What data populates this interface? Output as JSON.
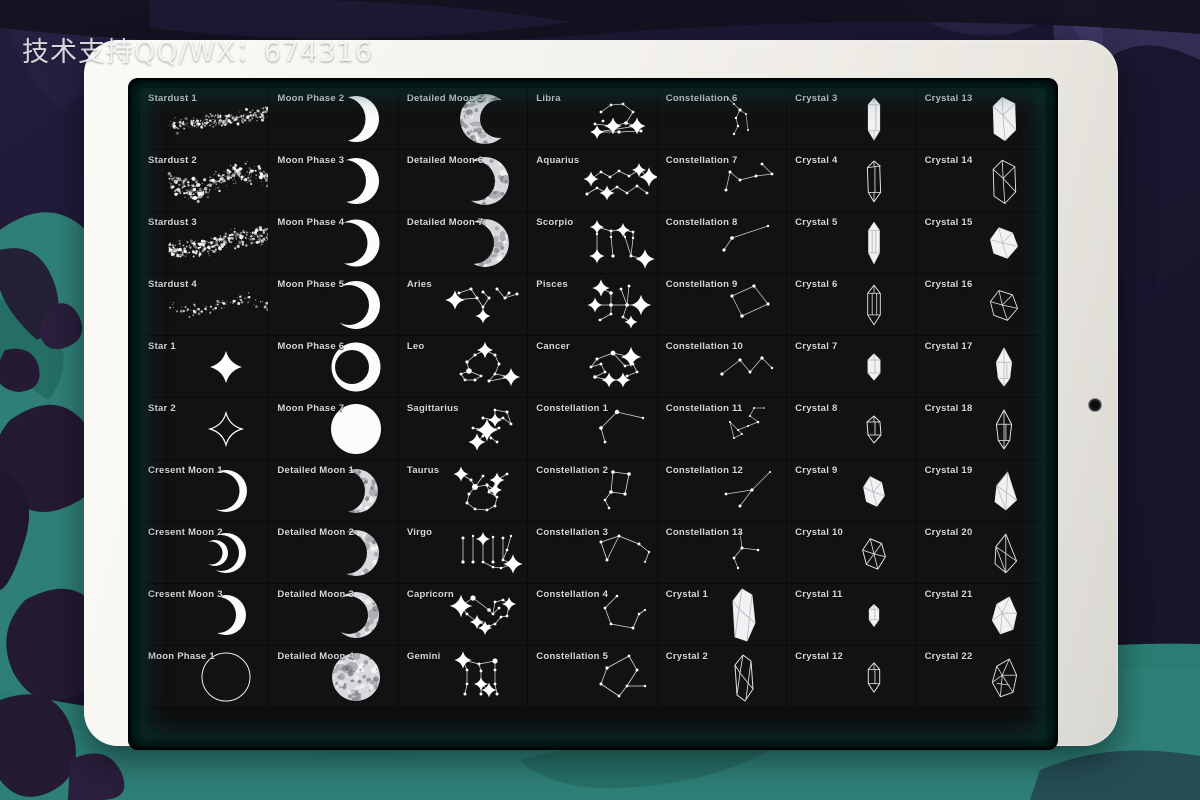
{
  "watermark": {
    "text": "技术支持QQ/WX：674316"
  },
  "device": {
    "name": "tablet",
    "bezel_color": "#f5f3ed",
    "screen_color": "#030304",
    "glow_color": "#0b7065",
    "camera_icon": "camera-dot"
  },
  "background": {
    "base_color": "#1b1530",
    "accent_teal": "#2e8077",
    "accent_purple": "#3a3560",
    "dark_plum": "#241a33"
  },
  "grid": {
    "columns": 7,
    "rows": 10,
    "label_color": "#d8d8da",
    "cell_color": "#121213",
    "items": [
      {
        "label": "Stardust 1",
        "art": "stardust-1",
        "wide": true
      },
      {
        "label": "Moon Phase 2",
        "art": "moon-phase-2"
      },
      {
        "label": "Detailed Moon 5",
        "art": "detailed-moon-5"
      },
      {
        "label": "Libra",
        "art": "libra"
      },
      {
        "label": "Constellation 6",
        "art": "constellation-6"
      },
      {
        "label": "Crystal 3",
        "art": "crystal-3"
      },
      {
        "label": "Crystal 13",
        "art": "crystal-13"
      },
      {
        "label": "Stardust 2",
        "art": "stardust-2",
        "wide": true
      },
      {
        "label": "Moon Phase 3",
        "art": "moon-phase-3"
      },
      {
        "label": "Detailed Moon 6",
        "art": "detailed-moon-6"
      },
      {
        "label": "Aquarius",
        "art": "aquarius"
      },
      {
        "label": "Constellation 7",
        "art": "constellation-7"
      },
      {
        "label": "Crystal 4",
        "art": "crystal-4"
      },
      {
        "label": "Crystal 14",
        "art": "crystal-14"
      },
      {
        "label": "Stardust 3",
        "art": "stardust-3",
        "wide": true
      },
      {
        "label": "Moon Phase 4",
        "art": "moon-phase-4"
      },
      {
        "label": "Detailed Moon 7",
        "art": "detailed-moon-7"
      },
      {
        "label": "Scorpio",
        "art": "scorpio"
      },
      {
        "label": "Constellation 8",
        "art": "constellation-8"
      },
      {
        "label": "Crystal 5",
        "art": "crystal-5"
      },
      {
        "label": "Crystal 15",
        "art": "crystal-15"
      },
      {
        "label": "Stardust 4",
        "art": "stardust-4",
        "wide": true
      },
      {
        "label": "Moon Phase 5",
        "art": "moon-phase-5"
      },
      {
        "label": "Aries",
        "art": "aries"
      },
      {
        "label": "Pisces",
        "art": "pisces"
      },
      {
        "label": "Constellation 9",
        "art": "constellation-9"
      },
      {
        "label": "Crystal 6",
        "art": "crystal-6"
      },
      {
        "label": "Crystal 16",
        "art": "crystal-16"
      },
      {
        "label": "Star 1",
        "art": "star-1"
      },
      {
        "label": "Moon Phase 6",
        "art": "moon-phase-6"
      },
      {
        "label": "Leo",
        "art": "leo"
      },
      {
        "label": "Cancer",
        "art": "cancer"
      },
      {
        "label": "Constellation 10",
        "art": "constellation-10"
      },
      {
        "label": "Crystal 7",
        "art": "crystal-7"
      },
      {
        "label": "Crystal 17",
        "art": "crystal-17"
      },
      {
        "label": "Star 2",
        "art": "star-2"
      },
      {
        "label": "Moon Phase 7",
        "art": "moon-phase-7"
      },
      {
        "label": "Sagittarius",
        "art": "sagittarius"
      },
      {
        "label": "Constellation 1",
        "art": "constellation-1"
      },
      {
        "label": "Constellation 11",
        "art": "constellation-11"
      },
      {
        "label": "Crystal 8",
        "art": "crystal-8"
      },
      {
        "label": "Crystal 18",
        "art": "crystal-18"
      },
      {
        "label": "Cresent Moon 1",
        "art": "cresent-moon-1"
      },
      {
        "label": "Detailed Moon 1",
        "art": "detailed-moon-1"
      },
      {
        "label": "Taurus",
        "art": "taurus"
      },
      {
        "label": "Constellation 2",
        "art": "constellation-2"
      },
      {
        "label": "Constellation 12",
        "art": "constellation-12"
      },
      {
        "label": "Crystal 9",
        "art": "crystal-9"
      },
      {
        "label": "Crystal 19",
        "art": "crystal-19"
      },
      {
        "label": "Cresent Moon 2",
        "art": "cresent-moon-2"
      },
      {
        "label": "Detailed Moon 2",
        "art": "detailed-moon-2"
      },
      {
        "label": "Virgo",
        "art": "virgo"
      },
      {
        "label": "Constellation 3",
        "art": "constellation-3"
      },
      {
        "label": "Constellation 13",
        "art": "constellation-13"
      },
      {
        "label": "Crystal 10",
        "art": "crystal-10"
      },
      {
        "label": "Crystal 20",
        "art": "crystal-20"
      },
      {
        "label": "Cresent Moon 3",
        "art": "cresent-moon-3"
      },
      {
        "label": "Detailed Moon 3",
        "art": "detailed-moon-3"
      },
      {
        "label": "Capricorn",
        "art": "capricorn"
      },
      {
        "label": "Constellation 4",
        "art": "constellation-4"
      },
      {
        "label": "Crystal 1",
        "art": "crystal-1"
      },
      {
        "label": "Crystal 11",
        "art": "crystal-11"
      },
      {
        "label": "Crystal 21",
        "art": "crystal-21"
      },
      {
        "label": "Moon Phase 1",
        "art": "moon-phase-1"
      },
      {
        "label": "Detailed Moon 4",
        "art": "detailed-moon-4"
      },
      {
        "label": "Gemini",
        "art": "gemini"
      },
      {
        "label": "Constellation 5",
        "art": "constellation-5"
      },
      {
        "label": "Crystal 2",
        "art": "crystal-2"
      },
      {
        "label": "Crystal 12",
        "art": "crystal-12"
      },
      {
        "label": "Crystal 22",
        "art": "crystal-22"
      }
    ]
  }
}
